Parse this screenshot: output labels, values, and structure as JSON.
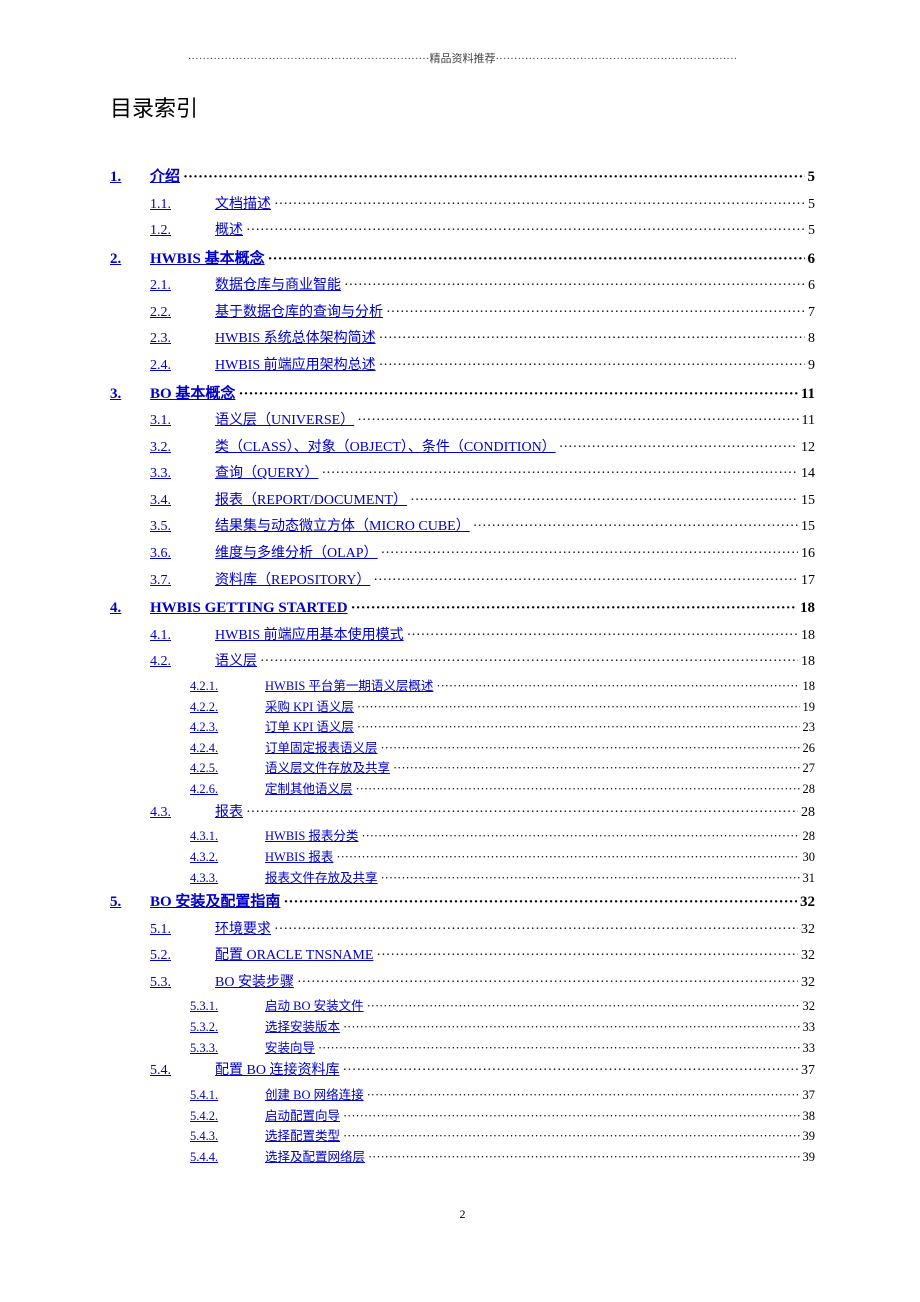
{
  "header": "精品资料推荐",
  "title": "目录索引",
  "page_number": "2",
  "toc": [
    {
      "level": 1,
      "num": "1.",
      "label": "介绍",
      "page": "5"
    },
    {
      "level": 2,
      "num": "1.1.",
      "label": "文档描述",
      "page": "5"
    },
    {
      "level": 2,
      "num": "1.2.",
      "label": "概述",
      "page": "5"
    },
    {
      "level": 1,
      "num": "2.",
      "label": "HWBIS 基本概念",
      "page": "6"
    },
    {
      "level": 2,
      "num": "2.1.",
      "label": "数据仓库与商业智能",
      "page": "6"
    },
    {
      "level": 2,
      "num": "2.2.",
      "label": "基于数据仓库的查询与分析",
      "page": "7"
    },
    {
      "level": 2,
      "num": "2.3.",
      "label": "HWBIS 系统总体架构简述",
      "page": "8"
    },
    {
      "level": 2,
      "num": "2.4.",
      "label": "HWBIS 前端应用架构总述",
      "page": "9"
    },
    {
      "level": 1,
      "num": "3.",
      "label": "BO 基本概念",
      "page": "11"
    },
    {
      "level": 2,
      "num": "3.1.",
      "label": "语义层（UNIVERSE）",
      "page": "11"
    },
    {
      "level": 2,
      "num": "3.2.",
      "label": "类（CLASS）、对象（OBJECT）、条件（CONDITION）",
      "page": "12"
    },
    {
      "level": 2,
      "num": "3.3.",
      "label": "查询（QUERY）",
      "page": "14"
    },
    {
      "level": 2,
      "num": "3.4.",
      "label": "报表（REPORT/DOCUMENT）",
      "page": "15"
    },
    {
      "level": 2,
      "num": "3.5.",
      "label": "结果集与动态微立方体（MICRO CUBE）",
      "page": "15"
    },
    {
      "level": 2,
      "num": "3.6.",
      "label": "维度与多维分析（OLAP）",
      "page": "16"
    },
    {
      "level": 2,
      "num": "3.7.",
      "label": "资料库（REPOSITORY）",
      "page": "17"
    },
    {
      "level": 1,
      "num": "4.",
      "label": "HWBIS GETTING STARTED",
      "page": "18"
    },
    {
      "level": 2,
      "num": "4.1.",
      "label": "HWBIS 前端应用基本使用模式",
      "page": "18"
    },
    {
      "level": 2,
      "num": "4.2.",
      "label": "语义层",
      "page": "18"
    },
    {
      "level": 3,
      "num": "4.2.1.",
      "label": "HWBIS 平台第一期语义层概述",
      "page": "18"
    },
    {
      "level": 3,
      "num": "4.2.2.",
      "label": "采购 KPI 语义层",
      "page": "19"
    },
    {
      "level": 3,
      "num": "4.2.3.",
      "label": "订单 KPI 语义层",
      "page": "23"
    },
    {
      "level": 3,
      "num": "4.2.4.",
      "label": "订单固定报表语义层",
      "page": "26"
    },
    {
      "level": 3,
      "num": "4.2.5.",
      "label": "语义层文件存放及共享",
      "page": "27"
    },
    {
      "level": 3,
      "num": "4.2.6.",
      "label": "定制其他语义层",
      "page": "28"
    },
    {
      "level": 2,
      "num": "4.3.",
      "label": "报表",
      "page": "28"
    },
    {
      "level": 3,
      "num": "4.3.1.",
      "label": "HWBIS 报表分类",
      "page": "28"
    },
    {
      "level": 3,
      "num": "4.3.2.",
      "label": "HWBIS 报表",
      "page": "30"
    },
    {
      "level": 3,
      "num": "4.3.3.",
      "label": "报表文件存放及共享",
      "page": "31"
    },
    {
      "level": 1,
      "num": "5.",
      "label": "BO 安装及配置指南",
      "page": "32"
    },
    {
      "level": 2,
      "num": "5.1.",
      "label": "环境要求",
      "page": "32"
    },
    {
      "level": 2,
      "num": "5.2.",
      "label": "配置 ORACLE TNSNAME",
      "page": "32"
    },
    {
      "level": 2,
      "num": "5.3.",
      "label": "BO 安装步骤",
      "page": "32"
    },
    {
      "level": 3,
      "num": "5.3.1.",
      "label": "启动 BO 安装文件",
      "page": "32"
    },
    {
      "level": 3,
      "num": "5.3.2.",
      "label": "选择安装版本",
      "page": "33"
    },
    {
      "level": 3,
      "num": "5.3.3.",
      "label": "安装向导",
      "page": "33"
    },
    {
      "level": 2,
      "num": "5.4.",
      "label": "配置 BO 连接资料库",
      "page": "37"
    },
    {
      "level": 3,
      "num": "5.4.1.",
      "label": "创建 BO 网络连接",
      "page": "37"
    },
    {
      "level": 3,
      "num": "5.4.2.",
      "label": "启动配置向导",
      "page": "38"
    },
    {
      "level": 3,
      "num": "5.4.3.",
      "label": "选择配置类型",
      "page": "39"
    },
    {
      "level": 3,
      "num": "5.4.4.",
      "label": "选择及配置网络层",
      "page": "39"
    }
  ]
}
